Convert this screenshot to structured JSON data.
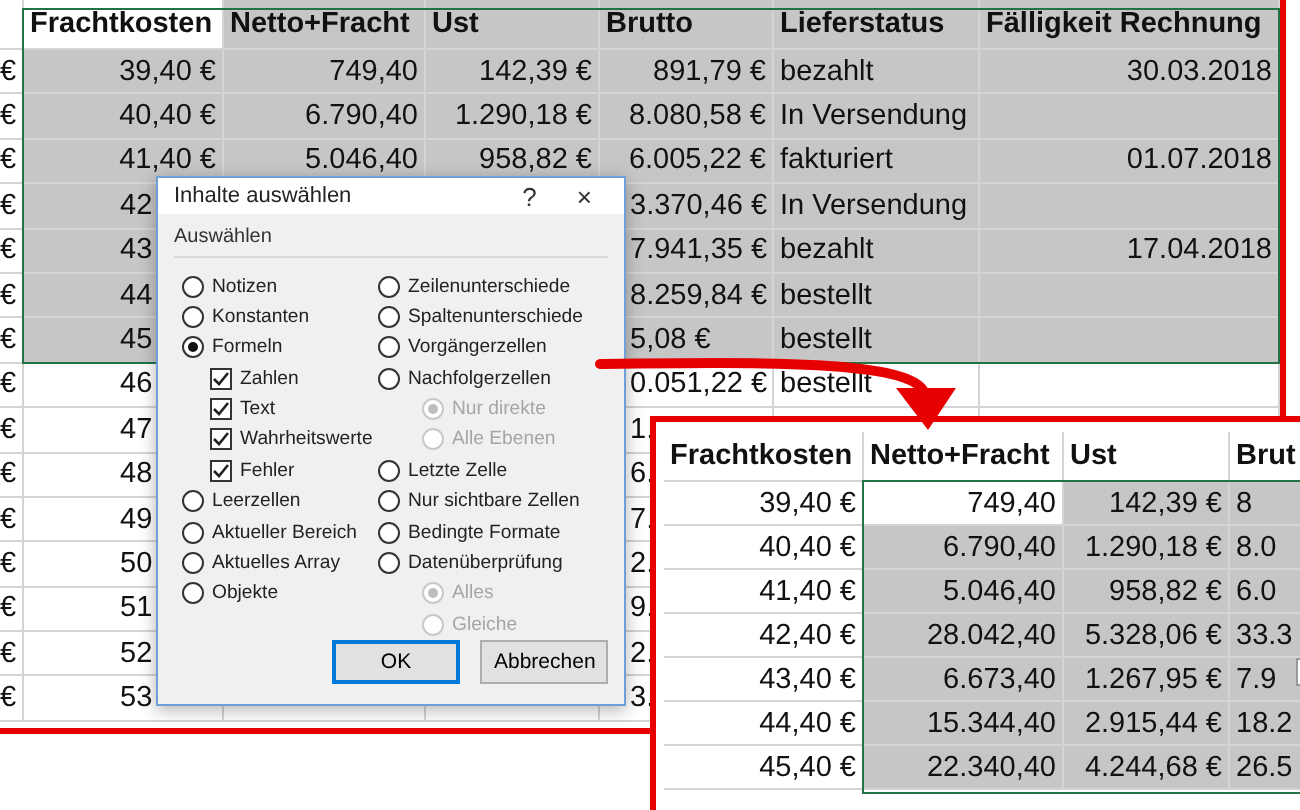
{
  "sheet": {
    "stub": "€",
    "columns": [
      {
        "label": "Frachtkosten",
        "selected": false
      },
      {
        "label": "Netto+Fracht",
        "selected": true
      },
      {
        "label": "Ust",
        "selected": true
      },
      {
        "label": "Brutto",
        "selected": true
      },
      {
        "label": "Lieferstatus",
        "selected": true
      },
      {
        "label": "Fälligkeit Rechnung",
        "selected": true
      }
    ],
    "rows": [
      {
        "selected": true,
        "cells": [
          {
            "kind": "number",
            "text": "39,40 €"
          },
          {
            "kind": "number",
            "text": "749,40"
          },
          {
            "kind": "number",
            "text": "142,39 €"
          },
          {
            "kind": "number",
            "text": "891,79 €"
          },
          {
            "kind": "text",
            "text": "bezahlt"
          },
          {
            "kind": "number",
            "text": "30.03.2018"
          }
        ]
      },
      {
        "selected": true,
        "cells": [
          {
            "kind": "number",
            "text": "40,40 €"
          },
          {
            "kind": "number",
            "text": "6.790,40"
          },
          {
            "kind": "number",
            "text": "1.290,18 €"
          },
          {
            "kind": "number",
            "text": "8.080,58 €"
          },
          {
            "kind": "text",
            "text": "In Versendung"
          },
          {
            "kind": "empty"
          }
        ]
      },
      {
        "selected": true,
        "cells": [
          {
            "kind": "number",
            "text": "41,40 €"
          },
          {
            "kind": "number",
            "text": "5.046,40"
          },
          {
            "kind": "number",
            "text": "958,82 €"
          },
          {
            "kind": "number",
            "text": "6.005,22 €"
          },
          {
            "kind": "text",
            "text": "fakturiert"
          },
          {
            "kind": "number",
            "text": "01.07.2018"
          }
        ]
      },
      {
        "selected": true,
        "cells": [
          {
            "kind": "cut",
            "text": "42"
          },
          {
            "kind": "empty"
          },
          {
            "kind": "empty"
          },
          {
            "kind": "cut",
            "text": "3.370,46 €"
          },
          {
            "kind": "text",
            "text": "In Versendung"
          },
          {
            "kind": "empty"
          }
        ]
      },
      {
        "selected": true,
        "cells": [
          {
            "kind": "cut",
            "text": "43"
          },
          {
            "kind": "empty"
          },
          {
            "kind": "empty"
          },
          {
            "kind": "cut",
            "text": "7.941,35 €"
          },
          {
            "kind": "text",
            "text": "bezahlt"
          },
          {
            "kind": "number",
            "text": "17.04.2018"
          }
        ]
      },
      {
        "selected": true,
        "cells": [
          {
            "kind": "cut",
            "text": "44"
          },
          {
            "kind": "empty"
          },
          {
            "kind": "empty"
          },
          {
            "kind": "cut",
            "text": "8.259,84 €"
          },
          {
            "kind": "text",
            "text": "bestellt"
          },
          {
            "kind": "empty"
          }
        ]
      },
      {
        "selected": true,
        "cells": [
          {
            "kind": "cut",
            "text": "45"
          },
          {
            "kind": "empty"
          },
          {
            "kind": "empty"
          },
          {
            "kind": "cut",
            "text": "5,08 €"
          },
          {
            "kind": "text",
            "text": "bestellt"
          },
          {
            "kind": "empty"
          }
        ]
      },
      {
        "selected": false,
        "cells": [
          {
            "kind": "cut",
            "text": "46"
          },
          {
            "kind": "empty"
          },
          {
            "kind": "empty"
          },
          {
            "kind": "cut",
            "text": "0.051,22 €"
          },
          {
            "kind": "text",
            "text": "bestellt"
          },
          {
            "kind": "empty"
          }
        ]
      },
      {
        "selected": false,
        "cells": [
          {
            "kind": "cut",
            "text": "47"
          },
          {
            "kind": "empty"
          },
          {
            "kind": "empty"
          },
          {
            "kind": "cut",
            "text": "1."
          }
        ]
      },
      {
        "selected": false,
        "cells": [
          {
            "kind": "cut",
            "text": "48"
          },
          {
            "kind": "empty"
          },
          {
            "kind": "empty"
          },
          {
            "kind": "cut",
            "text": "6."
          }
        ]
      },
      {
        "selected": false,
        "cells": [
          {
            "kind": "cut",
            "text": "49"
          },
          {
            "kind": "empty"
          },
          {
            "kind": "empty"
          },
          {
            "kind": "cut",
            "text": "7."
          }
        ]
      },
      {
        "selected": false,
        "cells": [
          {
            "kind": "cut",
            "text": "50"
          },
          {
            "kind": "empty"
          },
          {
            "kind": "empty"
          },
          {
            "kind": "cut",
            "text": "2."
          }
        ]
      },
      {
        "selected": false,
        "cells": [
          {
            "kind": "cut",
            "text": "51"
          },
          {
            "kind": "empty"
          },
          {
            "kind": "empty"
          },
          {
            "kind": "cut",
            "text": "9."
          }
        ]
      },
      {
        "selected": false,
        "cells": [
          {
            "kind": "cut",
            "text": "52"
          },
          {
            "kind": "empty"
          },
          {
            "kind": "empty"
          },
          {
            "kind": "cut",
            "text": "2."
          }
        ]
      },
      {
        "selected": false,
        "cells": [
          {
            "kind": "cut",
            "text": "53"
          },
          {
            "kind": "empty"
          },
          {
            "kind": "empty"
          },
          {
            "kind": "cut",
            "text": "3."
          }
        ]
      }
    ]
  },
  "dialog": {
    "title": "Inhalte auswählen",
    "help": "?",
    "close": "×",
    "group": "Auswählen",
    "left": [
      {
        "kind": "radio",
        "label": "Notizen",
        "selected": false,
        "disabled": false
      },
      {
        "kind": "radio",
        "label": "Konstanten",
        "selected": false,
        "disabled": false
      },
      {
        "kind": "radio",
        "label": "Formeln",
        "selected": true,
        "disabled": false
      },
      {
        "kind": "checkbox",
        "label": "Zahlen",
        "checked": true
      },
      {
        "kind": "checkbox",
        "label": "Text",
        "checked": true
      },
      {
        "kind": "checkbox",
        "label": "Wahrheitswerte",
        "checked": true
      },
      {
        "kind": "checkbox",
        "label": "Fehler",
        "checked": true
      },
      {
        "kind": "radio",
        "label": "Leerzellen",
        "selected": false,
        "disabled": false
      },
      {
        "kind": "radio",
        "label": "Aktueller Bereich",
        "selected": false,
        "disabled": false
      },
      {
        "kind": "radio",
        "label": "Aktuelles Array",
        "selected": false,
        "disabled": false
      },
      {
        "kind": "radio",
        "label": "Objekte",
        "selected": false,
        "disabled": false
      }
    ],
    "right": [
      {
        "kind": "radio",
        "label": "Zeilenunterschiede",
        "selected": false,
        "disabled": false
      },
      {
        "kind": "radio",
        "label": "Spaltenunterschiede",
        "selected": false,
        "disabled": false
      },
      {
        "kind": "radio",
        "label": "Vorgängerzellen",
        "selected": false,
        "disabled": false
      },
      {
        "kind": "radio",
        "label": "Nachfolgerzellen",
        "selected": false,
        "disabled": false
      },
      {
        "kind": "subradio",
        "label": "Nur direkte",
        "selected": true,
        "disabled": true
      },
      {
        "kind": "subradio",
        "label": "Alle Ebenen",
        "selected": false,
        "disabled": true
      },
      {
        "kind": "radio",
        "label": "Letzte Zelle",
        "selected": false,
        "disabled": false
      },
      {
        "kind": "radio",
        "label": "Nur sichtbare Zellen",
        "selected": false,
        "disabled": false
      },
      {
        "kind": "radio",
        "label": "Bedingte Formate",
        "selected": false,
        "disabled": false
      },
      {
        "kind": "radio",
        "label": "Datenüberprüfung",
        "selected": false,
        "disabled": false
      },
      {
        "kind": "subradio",
        "label": "Alles",
        "selected": true,
        "disabled": true
      },
      {
        "kind": "subradio",
        "label": "Gleiche",
        "selected": false,
        "disabled": true
      }
    ],
    "buttons": [
      {
        "label": "OK",
        "default": true
      },
      {
        "label": "Abbrechen",
        "default": false
      }
    ]
  },
  "zoom_inset": {
    "columns": [
      "Frachtkosten",
      "Netto+Fracht",
      "Ust",
      "Brut"
    ],
    "rows": [
      {
        "cells": [
          {
            "text": "39,40 €",
            "selected": false
          },
          {
            "text": "749,40",
            "selected": false
          },
          {
            "text": "142,39 €",
            "selected": true
          },
          {
            "text": "8",
            "selected": true
          }
        ]
      },
      {
        "cells": [
          {
            "text": "40,40 €",
            "selected": false
          },
          {
            "text": "6.790,40",
            "selected": true
          },
          {
            "text": "1.290,18 €",
            "selected": true
          },
          {
            "text": "8.0",
            "selected": true
          }
        ]
      },
      {
        "cells": [
          {
            "text": "41,40 €",
            "selected": false
          },
          {
            "text": "5.046,40",
            "selected": true
          },
          {
            "text": "958,82 €",
            "selected": true
          },
          {
            "text": "6.0",
            "selected": true
          }
        ]
      },
      {
        "cells": [
          {
            "text": "42,40 €",
            "selected": false
          },
          {
            "text": "28.042,40",
            "selected": true
          },
          {
            "text": "5.328,06 €",
            "selected": true
          },
          {
            "text": "33.3",
            "selected": true
          }
        ]
      },
      {
        "cells": [
          {
            "text": "43,40 €",
            "selected": false
          },
          {
            "text": "6.673,40",
            "selected": true
          },
          {
            "text": "1.267,95 €",
            "selected": true
          },
          {
            "text": "7.9",
            "selected": true
          }
        ]
      },
      {
        "cells": [
          {
            "text": "44,40 €",
            "selected": false
          },
          {
            "text": "15.344,40",
            "selected": true
          },
          {
            "text": "2.915,44 €",
            "selected": true
          },
          {
            "text": "18.2",
            "selected": true
          }
        ]
      },
      {
        "cells": [
          {
            "text": "45,40 €",
            "selected": false
          },
          {
            "text": "22.340,40",
            "selected": true
          },
          {
            "text": "4.244,68 €",
            "selected": true
          },
          {
            "text": "26.5",
            "selected": true
          }
        ]
      }
    ]
  }
}
